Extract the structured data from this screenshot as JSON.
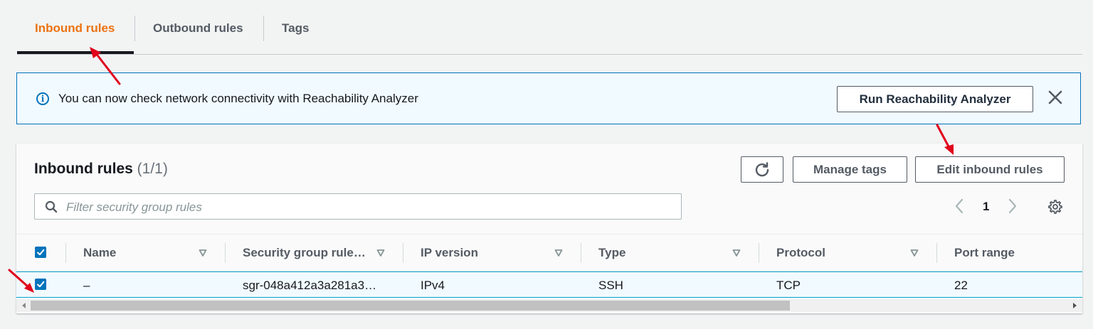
{
  "tabs": [
    {
      "label": "Inbound rules",
      "active": true
    },
    {
      "label": "Outbound rules",
      "active": false
    },
    {
      "label": "Tags",
      "active": false
    }
  ],
  "banner": {
    "icon": "info-icon",
    "text": "You can now check network connectivity with Reachability Analyzer",
    "button_label": "Run Reachability Analyzer",
    "close_icon": "close-icon"
  },
  "panel": {
    "title": "Inbound rules",
    "count": "(1/1)",
    "buttons": {
      "refresh_icon": "refresh-icon",
      "manage_tags": "Manage tags",
      "edit_inbound": "Edit inbound rules"
    },
    "filter": {
      "placeholder": "Filter security group rules",
      "value": ""
    },
    "pagination": {
      "current_page": "1"
    }
  },
  "table": {
    "header_select_all_checked": true,
    "columns": [
      "Name",
      "Security group rule…",
      "IP version",
      "Type",
      "Protocol",
      "Port range"
    ],
    "rows": [
      {
        "checked": true,
        "cells": [
          "–",
          "sgr-048a412a3a281a3…",
          "IPv4",
          "SSH",
          "TCP",
          "22"
        ]
      }
    ]
  },
  "colors": {
    "accent_orange": "#ec7211",
    "link_blue": "#0073bb",
    "annotation_red": "#e0001b"
  }
}
